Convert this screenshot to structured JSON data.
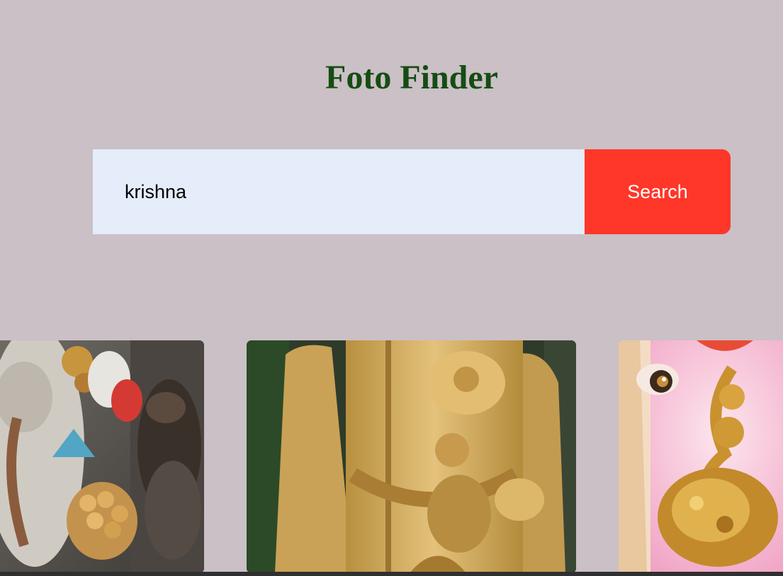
{
  "header": {
    "title": "Foto Finder"
  },
  "search": {
    "value": "krishna",
    "button_label": "Search"
  },
  "results": {
    "photos": [
      {
        "subject": "ganesha-figurines-photo"
      },
      {
        "subject": "golden-murugan-statue-photo"
      },
      {
        "subject": "ganesha-idol-closeup-photo"
      }
    ]
  }
}
